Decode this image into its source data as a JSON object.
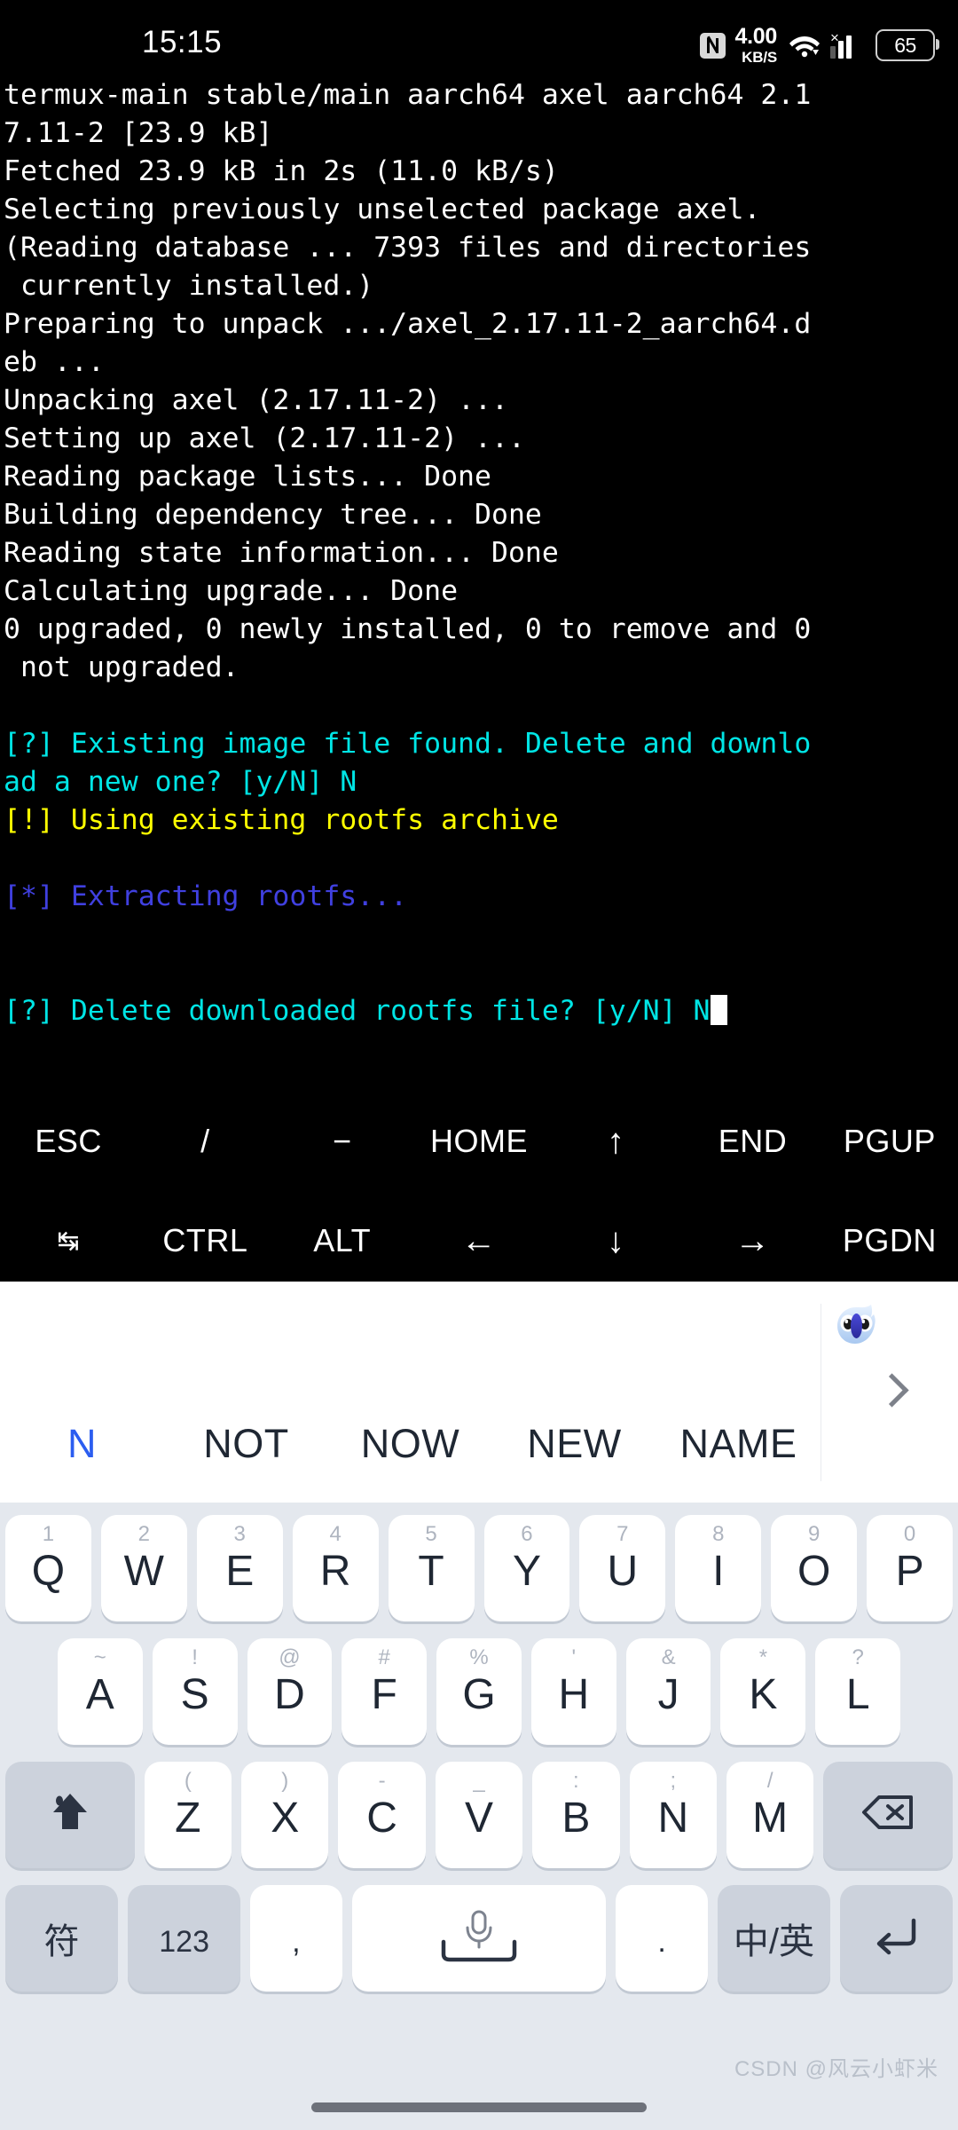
{
  "statusbar": {
    "time": "15:15",
    "nfc_icon": "nfc-icon",
    "netspeed_value": "4.00",
    "netspeed_unit": "KB/S",
    "wifi_icon": "wifi-icon",
    "signal_icon": "signal-bars-icon",
    "signal_badge": "×",
    "battery_level": "65"
  },
  "terminal": {
    "lines": [
      {
        "text": "termux-main stable/main aarch64 axel aarch64 2.1",
        "color": "white"
      },
      {
        "text": "7.11-2 [23.9 kB]",
        "color": "white"
      },
      {
        "text": "Fetched 23.9 kB in 2s (11.0 kB/s)",
        "color": "white"
      },
      {
        "text": "Selecting previously unselected package axel.",
        "color": "white"
      },
      {
        "text": "(Reading database ... 7393 files and directories",
        "color": "white"
      },
      {
        "text": " currently installed.)",
        "color": "white"
      },
      {
        "text": "Preparing to unpack .../axel_2.17.11-2_aarch64.d",
        "color": "white"
      },
      {
        "text": "eb ...",
        "color": "white"
      },
      {
        "text": "Unpacking axel (2.17.11-2) ...",
        "color": "white"
      },
      {
        "text": "Setting up axel (2.17.11-2) ...",
        "color": "white"
      },
      {
        "text": "Reading package lists... Done",
        "color": "white"
      },
      {
        "text": "Building dependency tree... Done",
        "color": "white"
      },
      {
        "text": "Reading state information... Done",
        "color": "white"
      },
      {
        "text": "Calculating upgrade... Done",
        "color": "white"
      },
      {
        "text": "0 upgraded, 0 newly installed, 0 to remove and 0",
        "color": "white"
      },
      {
        "text": " not upgraded.",
        "color": "white"
      },
      {
        "text": "",
        "color": "white"
      },
      {
        "text": "[?] Existing image file found. Delete and downlo",
        "color": "cyan"
      },
      {
        "text": "ad a new one? [y/N] N",
        "color": "cyan"
      },
      {
        "text": "[!] Using existing rootfs archive",
        "color": "yellow"
      },
      {
        "text": "",
        "color": "white"
      },
      {
        "text": "[*] Extracting rootfs...",
        "color": "blue"
      },
      {
        "text": "",
        "color": "white"
      },
      {
        "text": "",
        "color": "white"
      },
      {
        "text": "[?] Delete downloaded rootfs file? [y/N] N",
        "color": "cyan",
        "cursor": true
      }
    ],
    "colors": {
      "white": "#ffffff",
      "cyan": "#00e5e5",
      "yellow": "#ffff00",
      "blue": "#4040e0",
      "background": "#000000"
    }
  },
  "extra_keys": {
    "row1": [
      {
        "label": "ESC",
        "name": "esc-key"
      },
      {
        "label": "/",
        "name": "slash-key"
      },
      {
        "label": "−",
        "name": "minus-key"
      },
      {
        "label": "HOME",
        "name": "home-key"
      },
      {
        "label": "↑",
        "name": "arrow-up-key"
      },
      {
        "label": "END",
        "name": "end-key"
      },
      {
        "label": "PGUP",
        "name": "pgup-key"
      }
    ],
    "row2": [
      {
        "label": "↹",
        "name": "tab-key"
      },
      {
        "label": "CTRL",
        "name": "ctrl-key"
      },
      {
        "label": "ALT",
        "name": "alt-key"
      },
      {
        "label": "←",
        "name": "arrow-left-key"
      },
      {
        "label": "↓",
        "name": "arrow-down-key"
      },
      {
        "label": "→",
        "name": "arrow-right-key"
      },
      {
        "label": "PGDN",
        "name": "pgdn-key"
      }
    ]
  },
  "keyboard": {
    "suggestions": [
      {
        "word": "N",
        "active": true
      },
      {
        "word": "NOT",
        "active": false
      },
      {
        "word": "NOW",
        "active": false
      },
      {
        "word": "NEW",
        "active": false
      },
      {
        "word": "NAME",
        "active": false
      }
    ],
    "more_icon": "chevron-right-icon",
    "mascot_icon": "ime-bird-mascot-icon",
    "row1": [
      {
        "main": "Q",
        "hint": "1"
      },
      {
        "main": "W",
        "hint": "2"
      },
      {
        "main": "E",
        "hint": "3"
      },
      {
        "main": "R",
        "hint": "4"
      },
      {
        "main": "T",
        "hint": "5"
      },
      {
        "main": "Y",
        "hint": "6"
      },
      {
        "main": "U",
        "hint": "7"
      },
      {
        "main": "I",
        "hint": "8"
      },
      {
        "main": "O",
        "hint": "9"
      },
      {
        "main": "P",
        "hint": "0"
      }
    ],
    "row2": [
      {
        "main": "A",
        "hint": "~"
      },
      {
        "main": "S",
        "hint": "!"
      },
      {
        "main": "D",
        "hint": "@"
      },
      {
        "main": "F",
        "hint": "#"
      },
      {
        "main": "G",
        "hint": "%"
      },
      {
        "main": "H",
        "hint": "'"
      },
      {
        "main": "J",
        "hint": "&"
      },
      {
        "main": "K",
        "hint": "*"
      },
      {
        "main": "L",
        "hint": "?"
      }
    ],
    "row3": [
      {
        "main": "Z",
        "hint": "("
      },
      {
        "main": "X",
        "hint": ")"
      },
      {
        "main": "C",
        "hint": "-"
      },
      {
        "main": "V",
        "hint": "_"
      },
      {
        "main": "B",
        "hint": ":"
      },
      {
        "main": "N",
        "hint": ";"
      },
      {
        "main": "M",
        "hint": "/"
      }
    ],
    "shift_icon": "shift-arrow-icon",
    "backspace_icon": "backspace-icon",
    "row4": {
      "symbols_label": "符",
      "numbers_label": "123",
      "comma_label": ",",
      "space_icon": "space-bar-with-mic-icon",
      "period_label": ".",
      "language_label": "中/英",
      "enter_icon": "enter-return-icon"
    },
    "colors": {
      "key_face": "#ffffff",
      "key_gray": "#ccd2dc",
      "keyboard_bg": "#e4e8ee",
      "suggest_bg": "#ffffff",
      "active_suggestion": "#2b5df0",
      "text": "#1f2733"
    }
  },
  "watermark": {
    "text": "CSDN @风云小虾米"
  }
}
